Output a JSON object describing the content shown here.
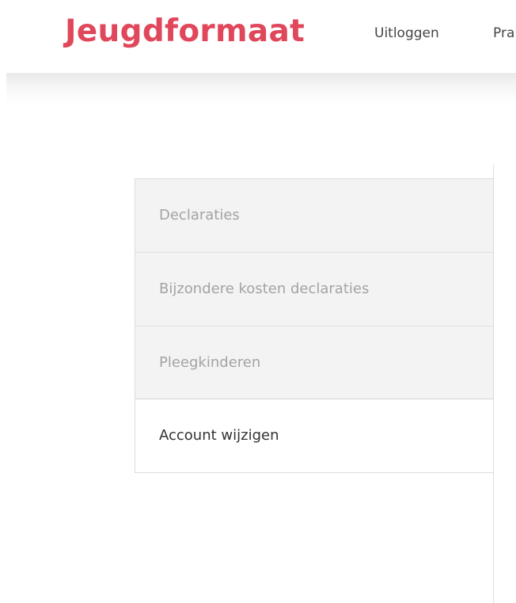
{
  "header": {
    "logo_text": "Jeugdformaat",
    "nav": {
      "logout_label": "Uitloggen",
      "next_label_partial": "Pra"
    }
  },
  "sidebar": {
    "items": [
      {
        "label": "Declaraties",
        "active": false
      },
      {
        "label": "Bijzondere kosten declaraties",
        "active": false
      },
      {
        "label": "Pleegkinderen",
        "active": false
      },
      {
        "label": "Account wijzigen",
        "active": true
      }
    ]
  },
  "colors": {
    "brand": "#e0475b",
    "menu_inactive_bg": "#f3f3f3",
    "menu_inactive_text": "#a3a3a3",
    "menu_active_text": "#333333",
    "nav_text": "#444444"
  }
}
